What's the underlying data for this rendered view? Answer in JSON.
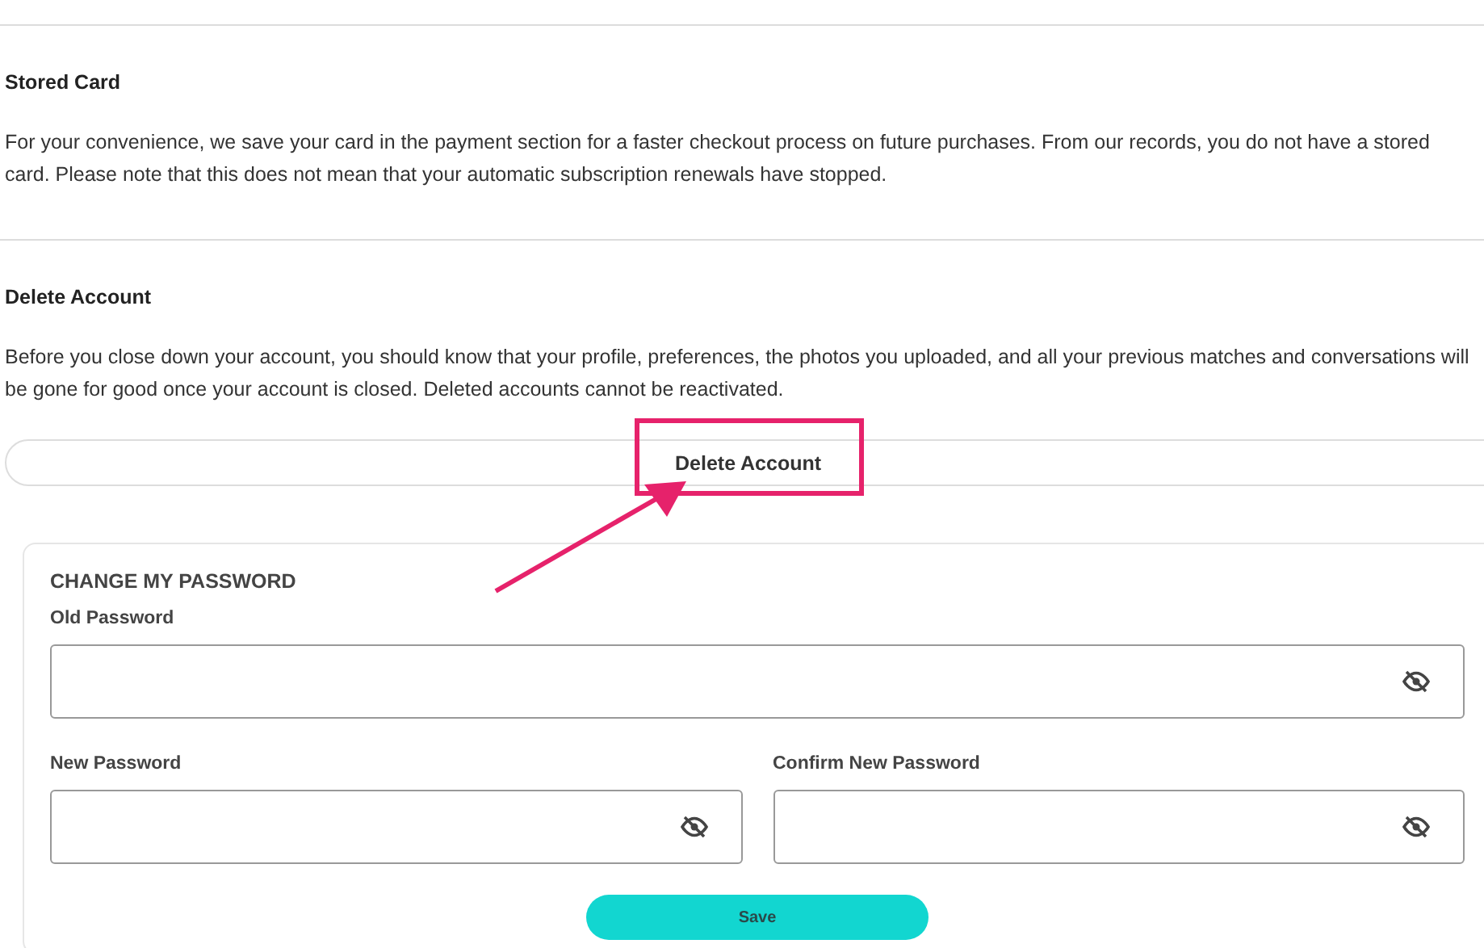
{
  "sections": [
    {
      "title": "Stored Card",
      "text": "For your convenience, we save your card in the payment section for a faster checkout process on future purchases. From our records, you do not have a stored card. Please note that this does not mean that your automatic subscription renewals have stopped."
    },
    {
      "title": "Delete Account",
      "text": "Before you close down your account, you should know that your profile, preferences, the photos you uploaded, and all your previous matches and conversations will be gone for good once your account is closed. Deleted accounts cannot be reactivated."
    }
  ],
  "delete_button": {
    "label": "Delete Account",
    "highlighted": true
  },
  "password_form": {
    "title": "CHANGE MY PASSWORD",
    "fields": [
      {
        "label": "Old Password"
      },
      {
        "label": "New Password"
      },
      {
        "label": "Confirm New Password"
      }
    ],
    "save_button": "Save"
  }
}
